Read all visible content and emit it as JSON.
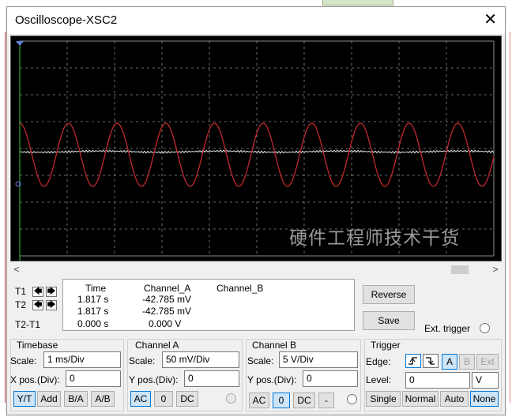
{
  "window": {
    "title": "Oscilloscope-XSC2",
    "close_glyph": "✕"
  },
  "screen": {
    "watermark": "硬件工程师技术干货",
    "trace_a_color": "#c0282c",
    "trace_b_color": "#e8e8e8",
    "grid_color": "#8a8a8a",
    "cursor1_color": "#37c837",
    "cursor2_color": "#7070ff"
  },
  "scrollbar": {
    "left_arrow": "<",
    "right_arrow": ">"
  },
  "cursors": {
    "t1_label": "T1",
    "t2_label": "T2",
    "diff_label": "T2-T1",
    "left_glyph": "🡄",
    "right_glyph": "🡆",
    "headers": {
      "time": "Time",
      "channel_a": "Channel_A",
      "channel_b": "Channel_B"
    },
    "rows": [
      {
        "time": "1.817 s",
        "channel_a": "-42.785 mV",
        "channel_b": ""
      },
      {
        "time": "1.817 s",
        "channel_a": "-42.785 mV",
        "channel_b": ""
      },
      {
        "time": "0.000 s",
        "channel_a": "0.000 V",
        "channel_b": ""
      }
    ]
  },
  "buttons": {
    "reverse": "Reverse",
    "save": "Save",
    "ext_trigger": "Ext. trigger"
  },
  "timebase": {
    "title": "Timebase",
    "scale_label": "Scale:",
    "scale_value": "1 ms/Div",
    "xpos_label": "X pos.(Div):",
    "xpos_value": "0",
    "modes": [
      "Y/T",
      "Add",
      "B/A",
      "A/B"
    ],
    "selected_mode": "Y/T"
  },
  "channel_a": {
    "title": "Channel A",
    "scale_label": "Scale:",
    "scale_value": "50 mV/Div",
    "ypos_label": "Y pos.(Div):",
    "ypos_value": "0",
    "coupling": [
      "AC",
      "0",
      "DC"
    ],
    "selected_coupling": "AC"
  },
  "channel_b": {
    "title": "Channel B",
    "scale_label": "Scale:",
    "scale_value": "5  V/Div",
    "ypos_label": "Y pos.(Div):",
    "ypos_value": "0",
    "coupling": [
      "AC",
      "0",
      "DC",
      "-"
    ],
    "selected_coupling": "0"
  },
  "trigger": {
    "title": "Trigger",
    "edge_label": "Edge:",
    "edge_sources": [
      "A",
      "B",
      "Ext"
    ],
    "selected_source": "A",
    "level_label": "Level:",
    "level_value": "0",
    "level_unit": "V",
    "modes": [
      "Single",
      "Normal",
      "Auto",
      "None"
    ],
    "selected_mode": "None"
  }
}
